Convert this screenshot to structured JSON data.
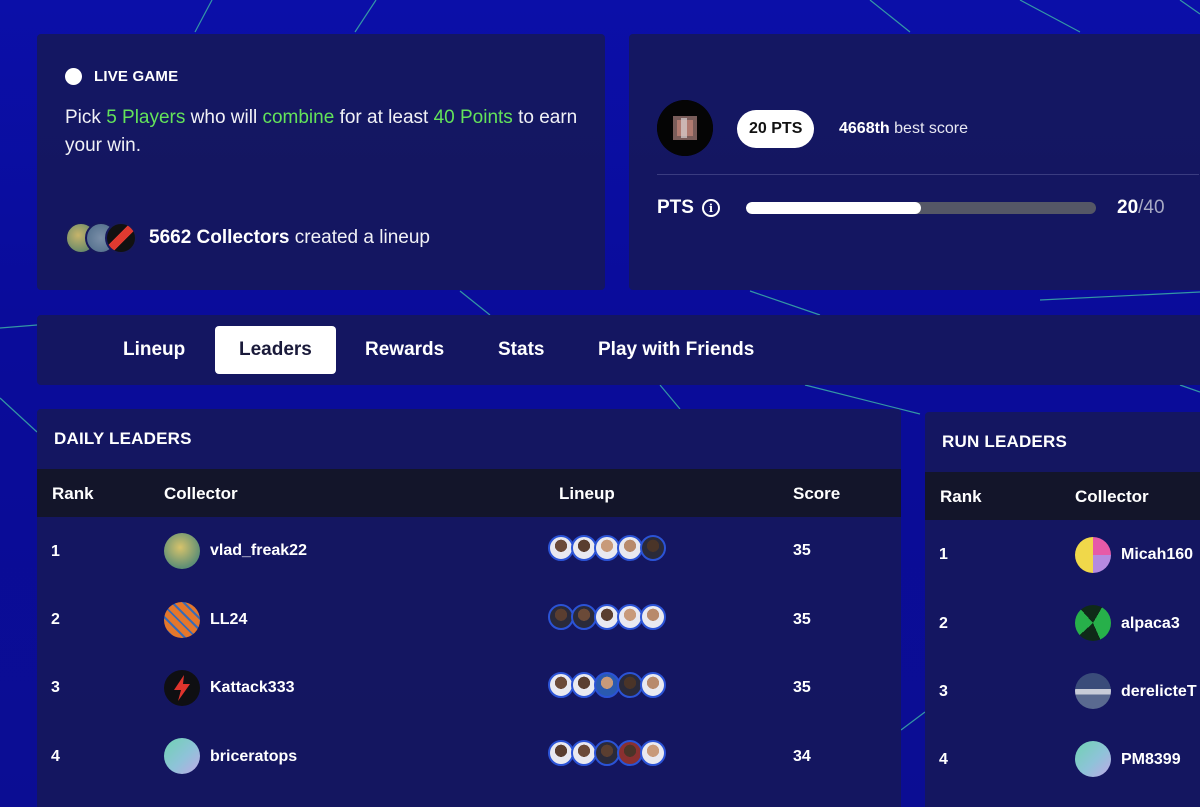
{
  "live_game": {
    "label": "LIVE GAME",
    "pick_prefix": "Pick ",
    "pick_players": "5 Players",
    "pick_mid1": " who will ",
    "pick_combine": "combine",
    "pick_mid2": " for at least ",
    "pick_points": "40 Points",
    "pick_suffix": " to earn your win.",
    "collectors_count": "5662 Collectors",
    "collectors_suffix": " created a lineup"
  },
  "score": {
    "pts_badge": "20 PTS",
    "rank_bold": "4668th",
    "rank_suffix": " best score",
    "pts_label": "PTS",
    "info_glyph": "i",
    "progress_current": "20",
    "progress_total": "/40",
    "progress_fraction": 0.5
  },
  "tabs": [
    {
      "label": "Lineup",
      "active": false
    },
    {
      "label": "Leaders",
      "active": true
    },
    {
      "label": "Rewards",
      "active": false
    },
    {
      "label": "Stats",
      "active": false
    },
    {
      "label": "Play with Friends",
      "active": false
    }
  ],
  "daily_leaders": {
    "title": "DAILY LEADERS",
    "columns": {
      "rank": "Rank",
      "collector": "Collector",
      "lineup": "Lineup",
      "score": "Score"
    },
    "rows": [
      {
        "rank": "1",
        "collector": "vlad_freak22",
        "score": "35",
        "avatar": "cartoon-avatar"
      },
      {
        "rank": "2",
        "collector": "LL24",
        "score": "35",
        "avatar": "basketball-avatar"
      },
      {
        "rank": "3",
        "collector": "Kattack333",
        "score": "35",
        "avatar": "lightning-avatar"
      },
      {
        "rank": "4",
        "collector": "briceratops",
        "score": "34",
        "avatar": "gradient-avatar"
      }
    ]
  },
  "run_leaders": {
    "title": "RUN LEADERS",
    "columns": {
      "rank": "Rank",
      "collector": "Collector"
    },
    "rows": [
      {
        "rank": "1",
        "collector": "Micah160",
        "avatar": "pie-avatar"
      },
      {
        "rank": "2",
        "collector": "alpaca3",
        "avatar": "green-swirl-avatar"
      },
      {
        "rank": "3",
        "collector": "derelicteT",
        "avatar": "photo-avatar"
      },
      {
        "rank": "4",
        "collector": "PM8399",
        "avatar": "gradient-avatar"
      }
    ]
  },
  "colors": {
    "background": "#0b0fa8",
    "panel": "#16185c",
    "highlight_green": "#63e35a",
    "header_row": "#13152a"
  }
}
